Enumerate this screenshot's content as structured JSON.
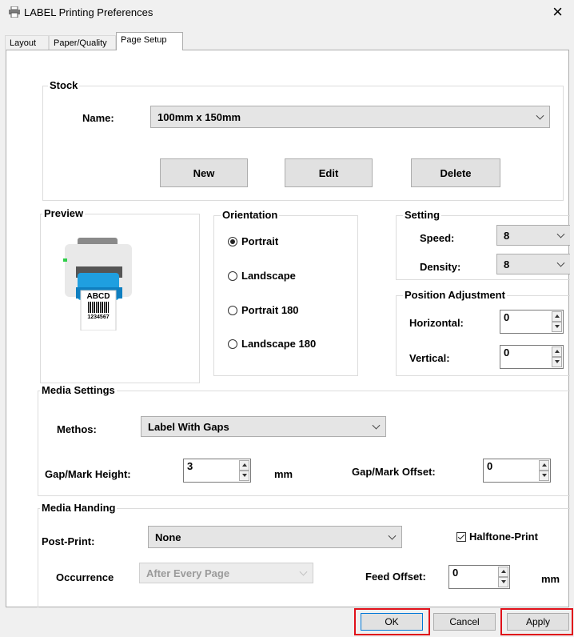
{
  "window": {
    "title": "LABEL Printing Preferences",
    "close_glyph": "×"
  },
  "tabs": [
    {
      "label": "Layout"
    },
    {
      "label": "Paper/Quality"
    },
    {
      "label": "Page Setup",
      "active": true
    }
  ],
  "stock": {
    "title": "Stock",
    "name_label": "Name:",
    "name_value": "100mm x 150mm",
    "buttons": {
      "new": "New",
      "edit": "Edit",
      "delete": "Delete"
    }
  },
  "preview": {
    "title": "Preview",
    "label_text": "ABCD",
    "label_number": "1234567"
  },
  "orientation": {
    "title": "Orientation",
    "options": [
      {
        "label": "Portrait",
        "selected": true
      },
      {
        "label": "Landscape",
        "selected": false
      },
      {
        "label": "Portrait 180",
        "selected": false
      },
      {
        "label": "Landscape 180",
        "selected": false
      }
    ]
  },
  "setting": {
    "title": "Setting",
    "speed_label": "Speed:",
    "speed_value": "8",
    "density_label": "Density:",
    "density_value": "8"
  },
  "position_adjustment": {
    "title": "Position Adjustment",
    "horizontal_label": "Horizontal:",
    "horizontal_value": "0",
    "vertical_label": "Vertical:",
    "vertical_value": "0"
  },
  "media_settings": {
    "title": "Media Settings",
    "methos_label": "Methos:",
    "methos_value": "Label With Gaps",
    "gap_height_label": "Gap/Mark Height:",
    "gap_height_value": "3",
    "gap_height_unit": "mm",
    "gap_offset_label": "Gap/Mark Offset:",
    "gap_offset_value": "0"
  },
  "media_handing": {
    "title": "Media Handing",
    "post_print_label": "Post-Print:",
    "post_print_value": "None",
    "halftone_label": "Halftone-Print",
    "halftone_checked": true,
    "occurrence_label": "Occurrence",
    "occurrence_value": "After Every Page",
    "feed_offset_label": "Feed Offset:",
    "feed_offset_value": "0",
    "feed_offset_unit": "mm"
  },
  "footer": {
    "ok": "OK",
    "cancel": "Cancel",
    "apply": "Apply"
  },
  "colors": {
    "highlight": "#e0101a",
    "printer_body": "#e9e9e9",
    "printer_label": "#1f9fe0"
  }
}
